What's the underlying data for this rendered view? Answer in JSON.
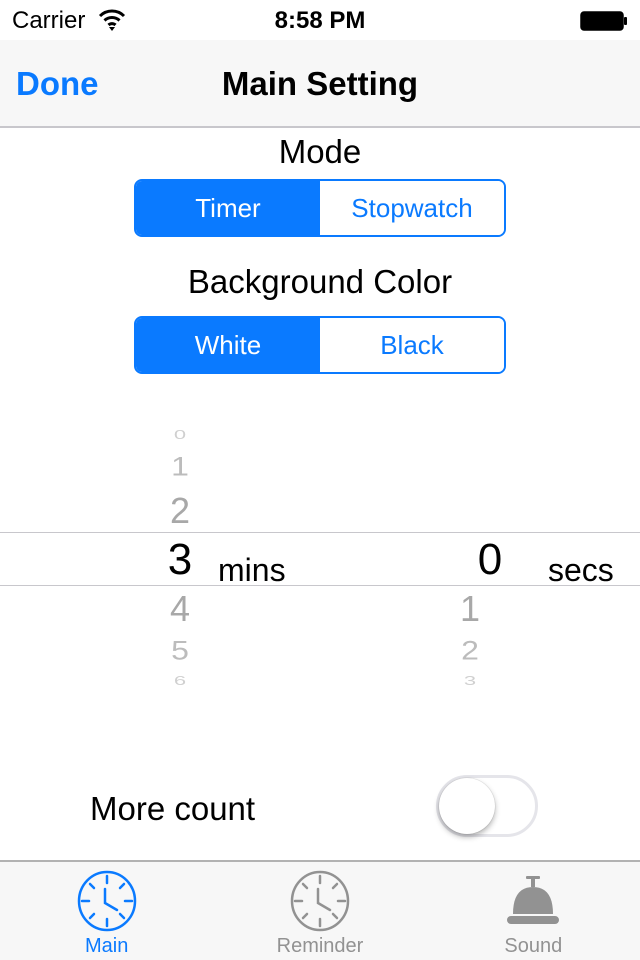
{
  "status_bar": {
    "carrier": "Carrier",
    "time": "8:58 PM",
    "wifi_icon": "wifi-icon",
    "battery_icon": "battery-icon"
  },
  "nav_bar": {
    "done_label": "Done",
    "title": "Main Setting"
  },
  "mode": {
    "label": "Mode",
    "options": [
      "Timer",
      "Stopwatch"
    ],
    "selected": "Timer"
  },
  "background_color": {
    "label": "Background Color",
    "options": [
      "White",
      "Black"
    ],
    "selected": "White"
  },
  "picker": {
    "minutes": {
      "above": [
        "0",
        "1",
        "2"
      ],
      "selected": "3",
      "below": [
        "4",
        "5",
        "6"
      ],
      "unit": "mins"
    },
    "seconds": {
      "selected": "0",
      "below": [
        "1",
        "2",
        "3"
      ],
      "unit": "secs"
    }
  },
  "more_count": {
    "label": "More count",
    "enabled": false
  },
  "tab_bar": {
    "items": [
      {
        "label": "Main",
        "icon": "clock-icon",
        "active": true
      },
      {
        "label": "Reminder",
        "icon": "clock-icon",
        "active": false
      },
      {
        "label": "Sound",
        "icon": "bell-icon",
        "active": false
      }
    ]
  },
  "colors": {
    "accent": "#0a7aff",
    "inactive_tab": "#929292",
    "picker_faded": "#a8a8a8"
  }
}
